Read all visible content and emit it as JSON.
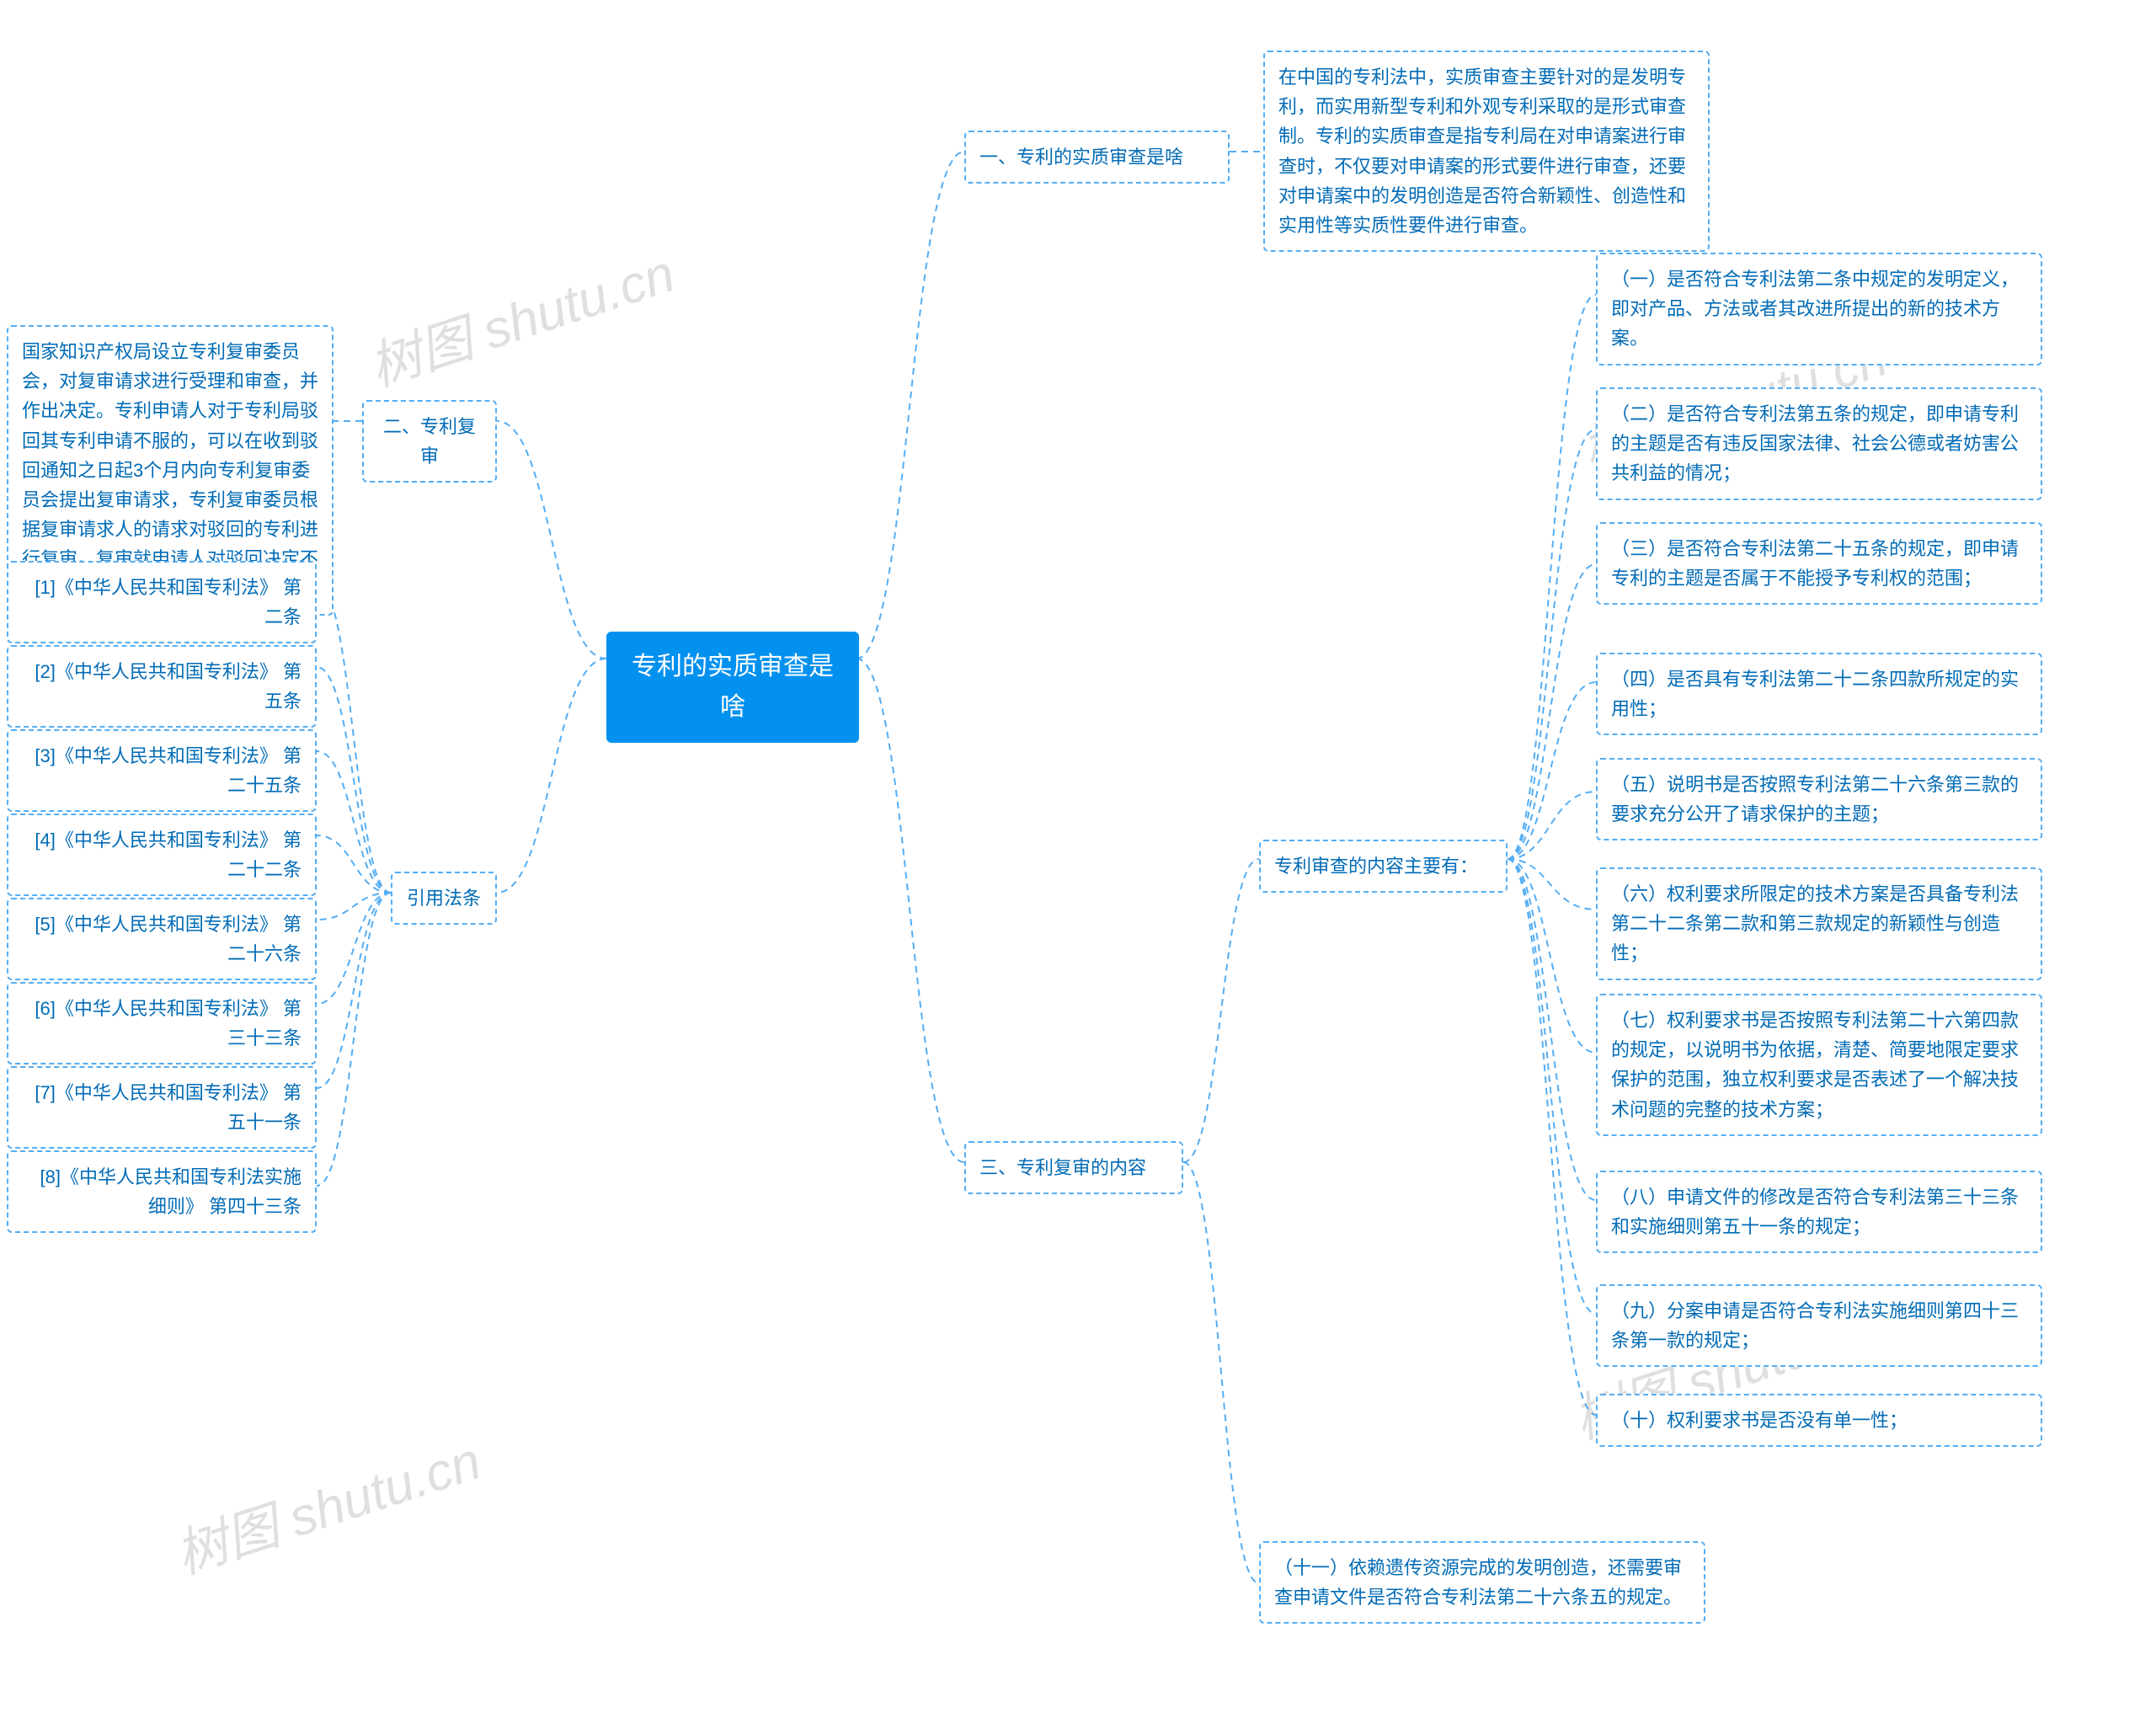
{
  "watermark": "树图 shutu.cn",
  "center": {
    "title": "专利的实质审查是啥"
  },
  "level2": {
    "b1": {
      "label": "一、专利的实质审查是啥"
    },
    "b2": {
      "label": "二、专利复审"
    },
    "b3": {
      "label": "三、专利复审的内容"
    },
    "b4": {
      "label": "引用法条"
    }
  },
  "b1_desc": "在中国的专利法中，实质审查主要针对的是发明专利，而实用新型专利和外观专利采取的是形式审查制。专利的实质审查是指专利局在对申请案进行审查时，不仅要对申请案的形式要件进行审查，还要对申请案中的发明创造是否符合新颖性、创造性和实用性等实质性要件进行审查。",
  "b2_desc": "国家知识产权局设立专利复审委员会，对复审请求进行受理和审查，并作出决定。专利申请人对于专利局驳回其专利申请不服的，可以在收到驳回通知之日起3个月内向专利复审委员会提出复审请求，专利复审委员根据复审请求人的请求对驳回的专利进行复审。复审就申请人对驳回决定不服而启动的救济程序。",
  "b3": {
    "header": "专利审查的内容主要有：",
    "items": {
      "i1": "（一）是否符合专利法第二条中规定的发明定义，即对产品、方法或者其改进所提出的新的技术方案。",
      "i2": "（二）是否符合专利法第五条的规定，即申请专利的主题是否有违反国家法律、社会公德或者妨害公共利益的情况；",
      "i3": "（三）是否符合专利法第二十五条的规定，即申请专利的主题是否属于不能授予专利权的范围；",
      "i4": "（四）是否具有专利法第二十二条四款所规定的实用性；",
      "i5": "（五）说明书是否按照专利法第二十六条第三款的要求充分公开了请求保护的主题；",
      "i6": "（六）权利要求所限定的技术方案是否具备专利法第二十二条第二款和第三款规定的新颖性与创造性；",
      "i7": "（七）权利要求书是否按照专利法第二十六第四款的规定，以说明书为依据，清楚、简要地限定要求保护的范围，独立权利要求是否表述了一个解决技术问题的完整的技术方案；",
      "i8": "（八）申请文件的修改是否符合专利法第三十三条和实施细则第五十一条的规定；",
      "i9": "（九）分案申请是否符合专利法实施细则第四十三条第一款的规定；",
      "i10": "（十）权利要求书是否没有单一性；",
      "i11": "（十一）依赖遗传资源完成的发明创造，还需要审查申请文件是否符合专利法第二十六条五的规定。"
    }
  },
  "b4_items": {
    "r1": "[1]《中华人民共和国专利法》 第二条",
    "r2": "[2]《中华人民共和国专利法》 第五条",
    "r3": "[3]《中华人民共和国专利法》 第二十五条",
    "r4": "[4]《中华人民共和国专利法》 第二十二条",
    "r5": "[5]《中华人民共和国专利法》 第二十六条",
    "r6": "[6]《中华人民共和国专利法》 第三十三条",
    "r7": "[7]《中华人民共和国专利法》 第五十一条",
    "r8": "[8]《中华人民共和国专利法实施细则》 第四十三条"
  }
}
